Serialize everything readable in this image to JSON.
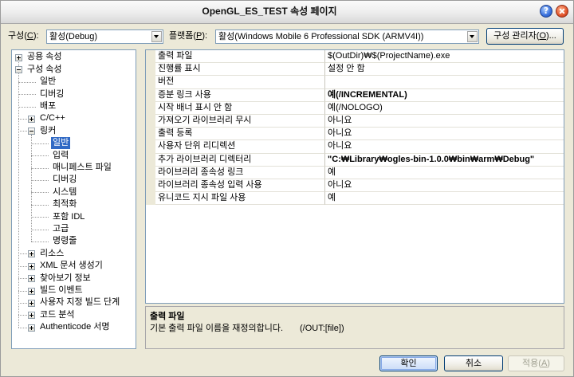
{
  "window": {
    "title": "OpenGL_ES_TEST 속성 페이지",
    "help_icon": "help-icon",
    "close_icon": "close-icon"
  },
  "config_bar": {
    "config_label": "구성(C):",
    "config_value": "활성(Debug)",
    "platform_label": "플랫폼(P):",
    "platform_value": "활성(Windows Mobile 6 Professional SDK (ARMV4I))",
    "manager_button": "구성 관리자(O)..."
  },
  "tree": [
    {
      "label": "공용 속성",
      "level": 0,
      "state": "collapsed"
    },
    {
      "label": "구성 속성",
      "level": 0,
      "state": "expanded"
    },
    {
      "label": "일반",
      "level": 1
    },
    {
      "label": "디버깅",
      "level": 1
    },
    {
      "label": "배포",
      "level": 1
    },
    {
      "label": "C/C++",
      "level": 1,
      "state": "collapsed"
    },
    {
      "label": "링커",
      "level": 1,
      "state": "expanded"
    },
    {
      "label": "일반",
      "level": 2,
      "selected": true
    },
    {
      "label": "입력",
      "level": 2
    },
    {
      "label": "매니페스트 파일",
      "level": 2
    },
    {
      "label": "디버깅",
      "level": 2
    },
    {
      "label": "시스템",
      "level": 2
    },
    {
      "label": "최적화",
      "level": 2
    },
    {
      "label": "포함 IDL",
      "level": 2
    },
    {
      "label": "고급",
      "level": 2
    },
    {
      "label": "명령줄",
      "level": 2
    },
    {
      "label": "리소스",
      "level": 1,
      "state": "collapsed"
    },
    {
      "label": "XML 문서 생성기",
      "level": 1,
      "state": "collapsed"
    },
    {
      "label": "찾아보기 정보",
      "level": 1,
      "state": "collapsed"
    },
    {
      "label": "빌드 이벤트",
      "level": 1,
      "state": "collapsed"
    },
    {
      "label": "사용자 지정 빌드 단계",
      "level": 1,
      "state": "collapsed"
    },
    {
      "label": "코드 분석",
      "level": 1,
      "state": "collapsed"
    },
    {
      "label": "Authenticode 서명",
      "level": 1,
      "state": "collapsed"
    }
  ],
  "properties": [
    {
      "name": "출력 파일",
      "value": "$(OutDir)₩$(ProjectName).exe"
    },
    {
      "name": "진행률 표시",
      "value": "설정 안 함"
    },
    {
      "name": "버전"
    },
    {
      "name": "증분 링크 사용",
      "value": "예(/INCREMENTAL)",
      "bold": true
    },
    {
      "name": "시작 배너 표시 안 함",
      "value": "예(/NOLOGO)"
    },
    {
      "name": "가져오기 라이브러리 무시",
      "value": "아니요"
    },
    {
      "name": "출력 등록",
      "value": "아니요"
    },
    {
      "name": "사용자 단위 리디렉션",
      "value": "아니요"
    },
    {
      "name": "추가 라이브러리 디렉터리",
      "value": "\"C:₩Library₩ogles-bin-1.0.0₩bin₩arm₩Debug\"",
      "bold": true
    },
    {
      "name": "라이브러리 종속성 링크",
      "value": "예"
    },
    {
      "name": "라이브러리 종속성 입력 사용",
      "value": "아니요"
    },
    {
      "name": "유니코드 지시 파일 사용",
      "value": "예"
    }
  ],
  "description": {
    "title": "출력 파일",
    "text": "기본 출력 파일 이름을 재정의합니다.",
    "switch": "(/OUT:[file])"
  },
  "buttons": {
    "ok": "확인",
    "cancel": "취소",
    "apply": "적용(A)",
    "apply_enabled": false
  },
  "colors": {
    "dialog_bg": "#ECE9D8",
    "selection": "#316AC5",
    "panel_border": "#7F9DB9",
    "disabled_text": "#A1A192"
  }
}
